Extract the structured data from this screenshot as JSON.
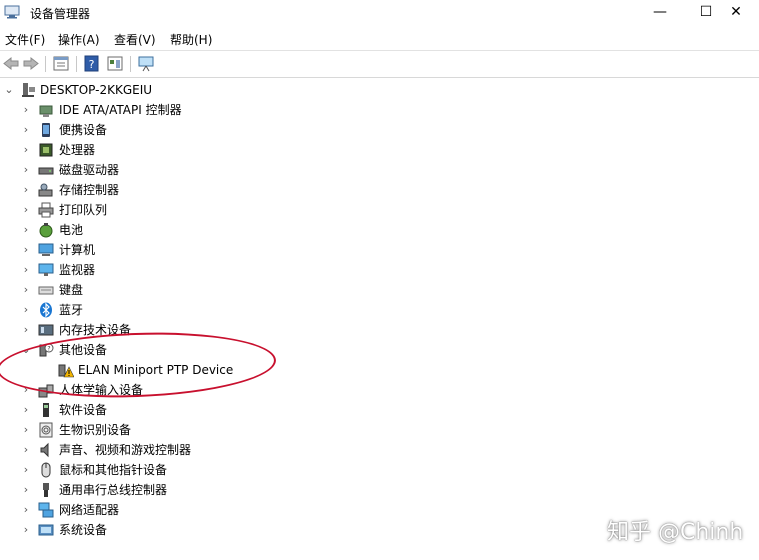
{
  "window": {
    "title": "设备管理器",
    "minimize": "—",
    "maximize": "☐",
    "close": "✕"
  },
  "menu": [
    "文件(F)",
    "操作(A)",
    "查看(V)",
    "帮助(H)"
  ],
  "toolbar": [
    "back-icon",
    "forward-icon",
    "properties-icon",
    "help-icon",
    "update-icon",
    "monitor-icon"
  ],
  "tree": {
    "root": "DESKTOP-2KKGEIU",
    "items": [
      {
        "label": "IDE ATA/ATAPI 控制器",
        "icon": "ide-controller-icon"
      },
      {
        "label": "便携设备",
        "icon": "portable-device-icon"
      },
      {
        "label": "处理器",
        "icon": "processor-icon"
      },
      {
        "label": "磁盘驱动器",
        "icon": "disk-drive-icon"
      },
      {
        "label": "存储控制器",
        "icon": "storage-controller-icon"
      },
      {
        "label": "打印队列",
        "icon": "printer-icon"
      },
      {
        "label": "电池",
        "icon": "battery-icon"
      },
      {
        "label": "计算机",
        "icon": "computer-icon"
      },
      {
        "label": "监视器",
        "icon": "monitor-icon"
      },
      {
        "label": "键盘",
        "icon": "keyboard-icon"
      },
      {
        "label": "蓝牙",
        "icon": "bluetooth-icon"
      },
      {
        "label": "内存技术设备",
        "icon": "memory-device-icon"
      },
      {
        "label": "其他设备",
        "icon": "other-devices-icon",
        "expanded": true
      },
      {
        "label": "ELAN Miniport PTP Device",
        "icon": "warning-device-icon",
        "child": true
      },
      {
        "label": "人体学输入设备",
        "icon": "hid-icon"
      },
      {
        "label": "软件设备",
        "icon": "software-device-icon"
      },
      {
        "label": "生物识别设备",
        "icon": "biometric-icon"
      },
      {
        "label": "声音、视频和游戏控制器",
        "icon": "sound-icon"
      },
      {
        "label": "鼠标和其他指针设备",
        "icon": "mouse-icon"
      },
      {
        "label": "通用串行总线控制器",
        "icon": "usb-icon"
      },
      {
        "label": "网络适配器",
        "icon": "network-adapter-icon"
      },
      {
        "label": "系统设备",
        "icon": "system-device-icon"
      }
    ]
  },
  "watermark": "知乎 @Chinh",
  "colors": {
    "annotation": "#c8102e",
    "warning": "#f2b400"
  }
}
